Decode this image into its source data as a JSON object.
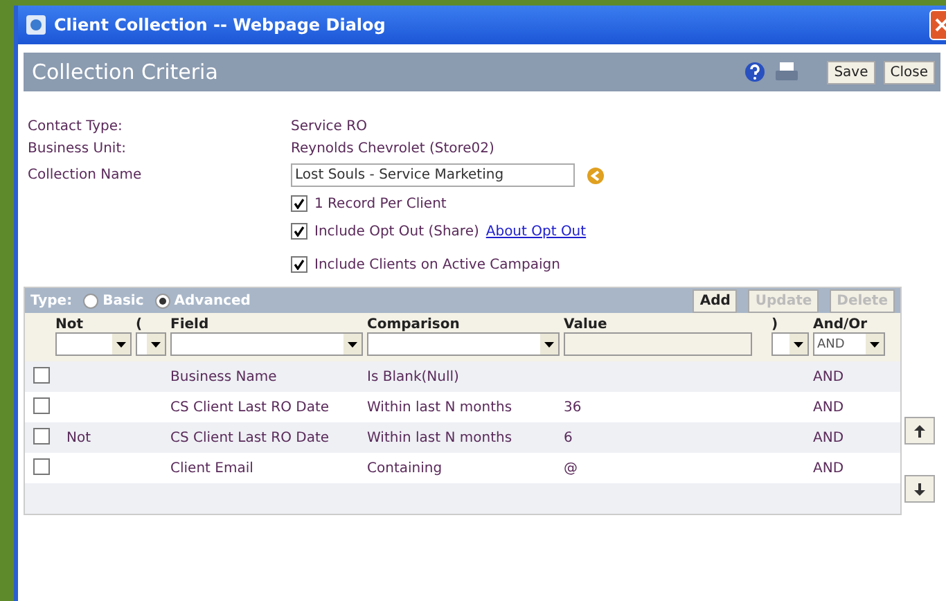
{
  "window": {
    "title": "Client Collection -- Webpage Dialog"
  },
  "header": {
    "title": "Collection Criteria",
    "buttons": [
      "Save",
      "Close"
    ]
  },
  "info": [
    {
      "label": "Contact Type:",
      "value": "Service RO"
    },
    {
      "label": "Business Unit:",
      "value": "Reynolds Chevrolet (Store02)"
    }
  ],
  "collection_name": {
    "label": "Collection Name",
    "value": "Lost Souls - Service Marketing"
  },
  "options": [
    {
      "label": "1 Record Per Client",
      "checked": true
    },
    {
      "label": "Include Opt Out (Share)",
      "checked": true,
      "link": "About Opt Out"
    },
    {
      "label": "Include Clients on Active Campaign",
      "checked": true
    }
  ],
  "criteria": {
    "type_label": "Type:",
    "types": [
      {
        "label": "Basic",
        "selected": false
      },
      {
        "label": "Advanced",
        "selected": true
      }
    ],
    "buttons": [
      {
        "label": "Add",
        "disabled": false
      },
      {
        "label": "Update",
        "disabled": true
      },
      {
        "label": "Delete",
        "disabled": true
      }
    ],
    "columns": [
      "Not",
      "(",
      "Field",
      "Comparison",
      "Value",
      ")",
      "And/Or"
    ],
    "and_or_value": "AND",
    "rows": [
      {
        "checked": false,
        "not": "",
        "field": "Business Name",
        "comparison": "Is Blank(Null)",
        "value": "",
        "and_or": "AND"
      },
      {
        "checked": false,
        "not": "",
        "field": "CS Client Last RO Date",
        "comparison": "Within last N months",
        "value": "36",
        "and_or": "AND"
      },
      {
        "checked": false,
        "not": "Not",
        "field": "CS Client Last RO Date",
        "comparison": "Within last N months",
        "value": "6",
        "and_or": "AND"
      },
      {
        "checked": false,
        "not": "",
        "field": "Client Email",
        "comparison": "Containing",
        "value": "@",
        "and_or": "AND"
      }
    ]
  }
}
